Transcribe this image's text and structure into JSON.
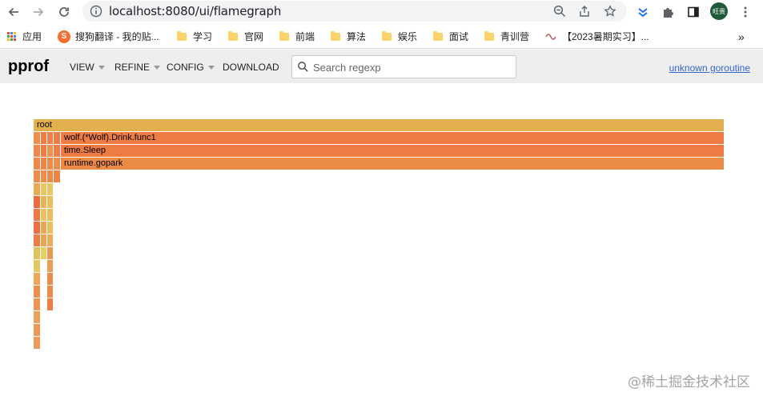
{
  "browser": {
    "url": "localhost:8080/ui/flamegraph",
    "avatar_text": "旺贵"
  },
  "bookmarks": [
    {
      "label": "应用",
      "icon": "apps-grid-icon"
    },
    {
      "label": "搜狗翻译 - 我的贴...",
      "icon": "sogou-icon"
    },
    {
      "label": "学习",
      "icon": "folder-icon"
    },
    {
      "label": "官网",
      "icon": "folder-icon"
    },
    {
      "label": "前端",
      "icon": "folder-icon"
    },
    {
      "label": "算法",
      "icon": "folder-icon"
    },
    {
      "label": "娱乐",
      "icon": "folder-icon"
    },
    {
      "label": "面试",
      "icon": "folder-icon"
    },
    {
      "label": "青训营",
      "icon": "folder-icon"
    },
    {
      "label": "【2023暑期实习】...",
      "icon": "site-favicon"
    }
  ],
  "bookmarks_more": "»",
  "pprof": {
    "logo": "pprof",
    "menu": [
      "VIEW",
      "REFINE",
      "CONFIG",
      "DOWNLOAD"
    ],
    "search_placeholder": "Search regexp",
    "link": "unknown goroutine"
  },
  "flame": {
    "frames": [
      {
        "label": "root",
        "color": "#e3b04f"
      },
      {
        "label": "wolf.(*Wolf).Drink.func1",
        "color": "#ef7c45"
      },
      {
        "label": "time.Sleep",
        "color": "#ee7b43"
      },
      {
        "label": "runtime.gopark",
        "color": "#ec8b48"
      }
    ]
  },
  "watermark": "@稀土掘金技术社区"
}
